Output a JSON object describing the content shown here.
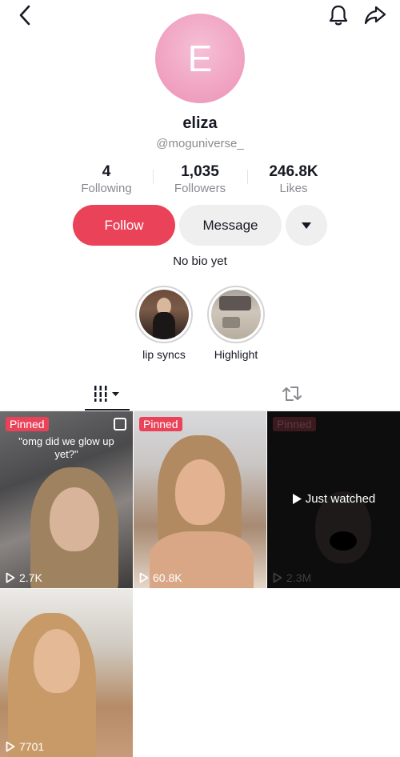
{
  "profile": {
    "avatar_letter": "E",
    "username": "eliza",
    "handle": "@moguniverse_",
    "bio": "No bio yet"
  },
  "stats": {
    "following": {
      "value": "4",
      "label": "Following"
    },
    "followers": {
      "value": "1,035",
      "label": "Followers"
    },
    "likes": {
      "value": "246.8K",
      "label": "Likes"
    }
  },
  "actions": {
    "follow_label": "Follow",
    "message_label": "Message"
  },
  "highlights": [
    {
      "label": "lip syncs"
    },
    {
      "label": "Highlight"
    }
  ],
  "tabs": {
    "videos_icon": "grid-icon",
    "reposts_icon": "repost-icon"
  },
  "videos": [
    {
      "pinned": "Pinned",
      "caption": "\"omg did we glow up yet?\"",
      "views": "2.7K"
    },
    {
      "pinned": "Pinned",
      "views": "60.8K"
    },
    {
      "pinned": "Pinned",
      "views": "2.3M",
      "overlay": "Just watched"
    },
    {
      "views": "7701"
    }
  ],
  "colors": {
    "accent": "#ea4359",
    "secondary_button": "#efeff0",
    "muted_text": "#8a8b91"
  }
}
